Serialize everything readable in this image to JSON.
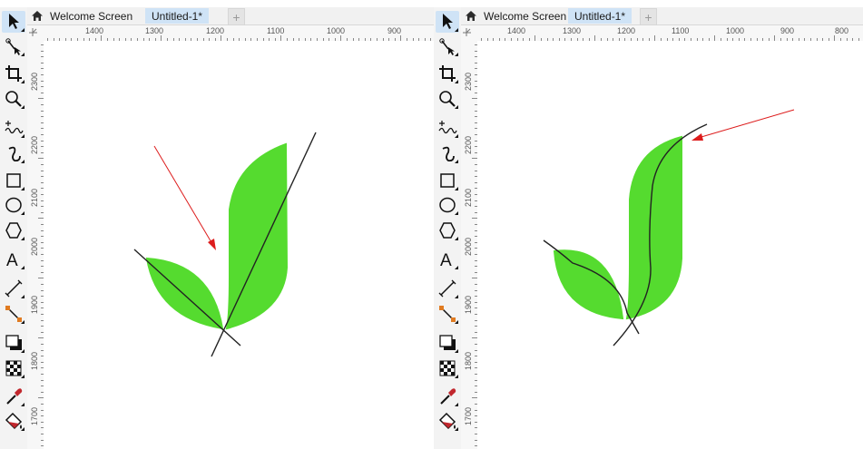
{
  "tabs": {
    "welcome_label": "Welcome Screen",
    "document_label": "Untitled-1*",
    "add_label": "+"
  },
  "left": {
    "hruler": [
      "1400",
      "1300",
      "1200",
      "1100",
      "1000",
      "900"
    ],
    "vruler": [
      "2300",
      "2200",
      "2100",
      "2000",
      "1900",
      "1800",
      "1700"
    ]
  },
  "right": {
    "hruler": [
      "1400",
      "1300",
      "1200",
      "1100",
      "1000",
      "900",
      "800"
    ],
    "vruler": [
      "2300",
      "2200",
      "2100",
      "2000",
      "1900",
      "1800",
      "1700"
    ]
  },
  "tools": [
    {
      "name": "pick-tool-icon",
      "active": true
    },
    {
      "name": "shape-tool-icon"
    },
    {
      "name": "crop-tool-icon"
    },
    {
      "name": "zoom-tool-icon"
    },
    {
      "name": "freehand-tool-icon"
    },
    {
      "name": "artistic-media-icon"
    },
    {
      "name": "rectangle-tool-icon"
    },
    {
      "name": "ellipse-tool-icon"
    },
    {
      "name": "polygon-tool-icon"
    },
    {
      "name": "text-tool-icon"
    },
    {
      "name": "parallel-dimension-icon"
    },
    {
      "name": "connector-tool-icon"
    },
    {
      "name": "drop-shadow-icon"
    },
    {
      "name": "transparency-icon"
    },
    {
      "name": "eyedropper-icon"
    },
    {
      "name": "interactive-fill-icon"
    }
  ],
  "colors": {
    "leaf": "#55db2f",
    "arrow": "#dd1c1c",
    "stroke": "#222222"
  }
}
